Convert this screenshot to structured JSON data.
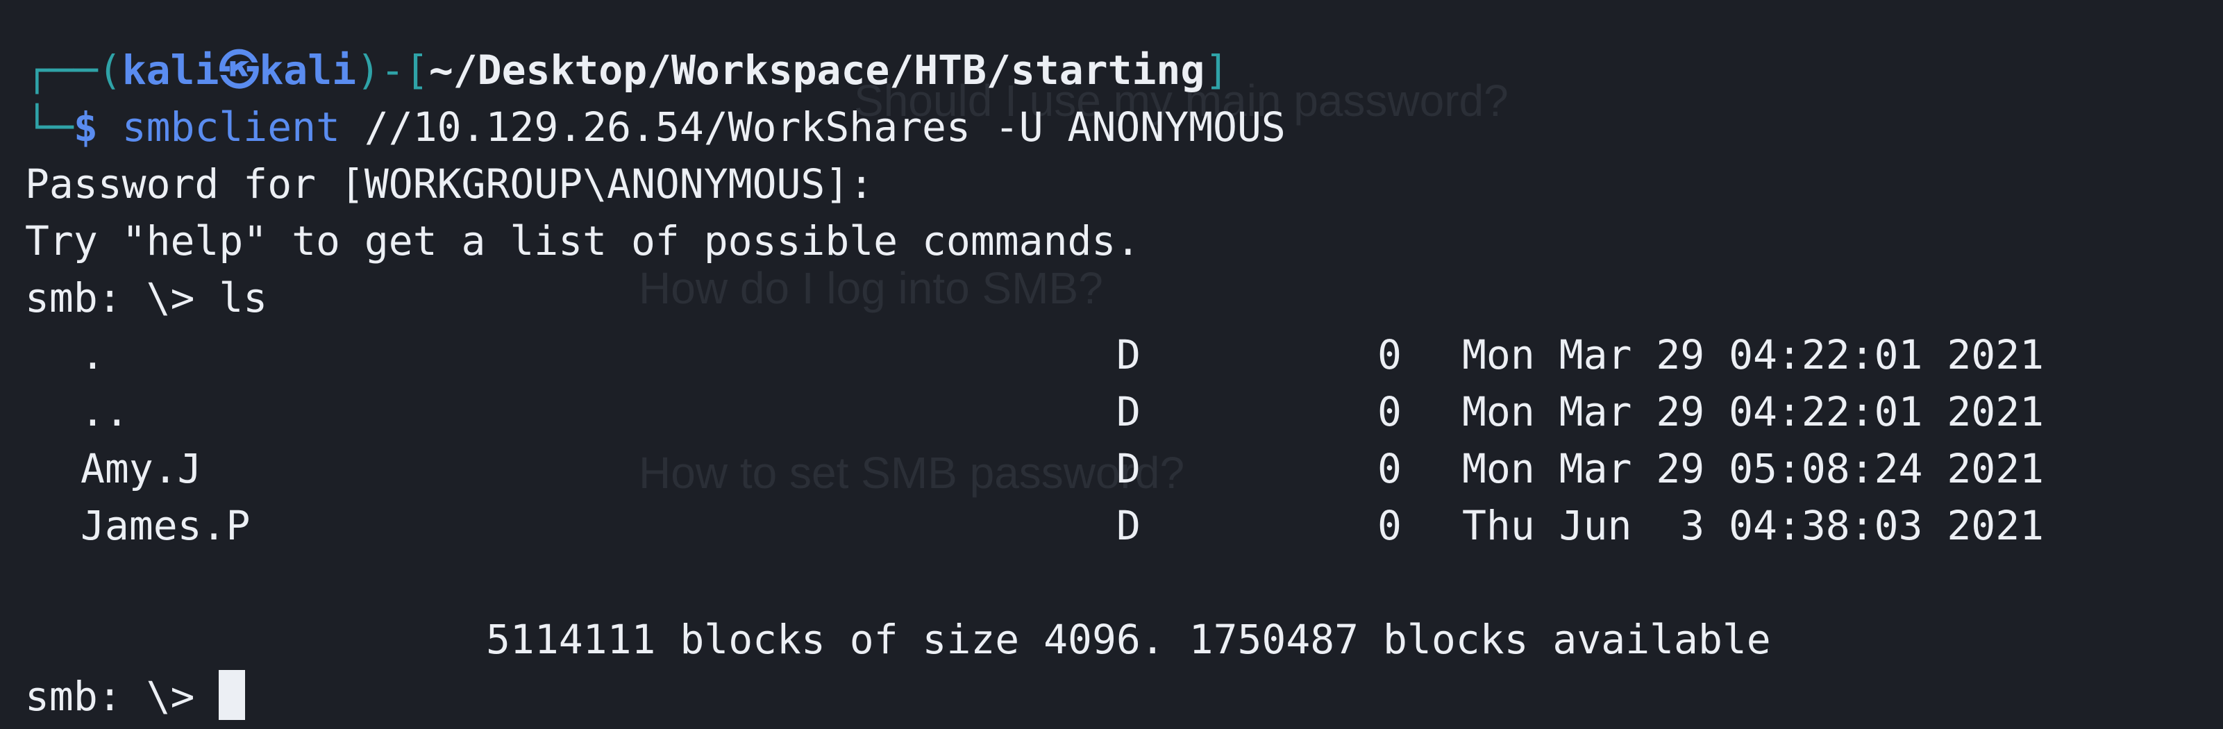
{
  "prompt": {
    "corner_top": "┌──(",
    "user": "kali",
    "at_symbol": "㉿",
    "host": "kali",
    "mid": ")-[",
    "path": "~/Desktop/Workspace/HTB/starting",
    "close": "]",
    "corner_bottom": "└─",
    "dollar": "$",
    "command_name": "smbclient",
    "command_args": "//10.129.26.54/WorkShares -U ANONYMOUS"
  },
  "output": {
    "password_line": "Password for [WORKGROUP\\ANONYMOUS]:",
    "help_line": "Try \"help\" to get a list of possible commands.",
    "smb_prompt_ls": "smb: \\> ls",
    "listing": [
      {
        "name": ".",
        "type": "D",
        "size": "0",
        "date": "Mon Mar 29 04:22:01 2021"
      },
      {
        "name": "..",
        "type": "D",
        "size": "0",
        "date": "Mon Mar 29 04:22:01 2021"
      },
      {
        "name": "Amy.J",
        "type": "D",
        "size": "0",
        "date": "Mon Mar 29 05:08:24 2021"
      },
      {
        "name": "James.P",
        "type": "D",
        "size": "0",
        "date": "Thu Jun  3 04:38:03 2021"
      }
    ],
    "blocks_line": "5114111 blocks of size 4096. 1750487 blocks available",
    "smb_prompt": "smb: \\> "
  },
  "ghost_text": {
    "top": "Should I use my main password?",
    "mid": "How do I log into SMB?",
    "lower": "How to set SMB password?"
  }
}
